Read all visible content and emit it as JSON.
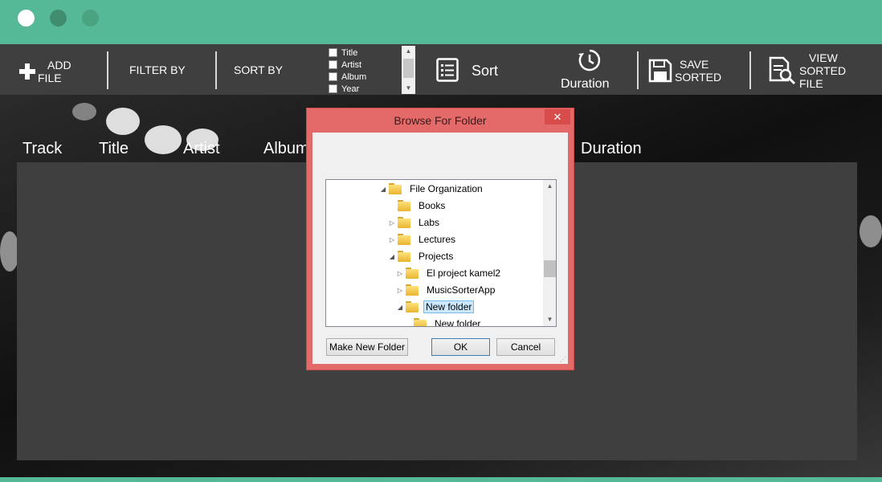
{
  "titlebar": {
    "accent": "#55b998"
  },
  "toolbar": {
    "add_file_line1": "ADD",
    "add_file_line2": "FILE",
    "filter_by": "FILTER BY",
    "sort_by": "SORT BY",
    "sort_fields": [
      "Title",
      "Artist",
      "Album",
      "Year"
    ],
    "sort_label": "Sort",
    "duration_label": "Duration",
    "save_line1": "SAVE",
    "save_line2": "SORTED",
    "view_line1": "VIEW",
    "view_line2": "SORTED",
    "view_line3": "FILE"
  },
  "columns": [
    "Track",
    "Title",
    "Artist",
    "Album",
    "Duration"
  ],
  "dialog": {
    "title": "Browse For Folder",
    "close_glyph": "✕",
    "tree": [
      {
        "label": "File Organization",
        "expander": "◢",
        "selected": false
      },
      {
        "label": "Books",
        "expander": "",
        "selected": false
      },
      {
        "label": "Labs",
        "expander": "▷",
        "selected": false
      },
      {
        "label": "Lectures",
        "expander": "▷",
        "selected": false
      },
      {
        "label": "Projects",
        "expander": "◢",
        "selected": false
      },
      {
        "label": "El project kamel2",
        "expander": "▷",
        "selected": false
      },
      {
        "label": "MusicSorterApp",
        "expander": "▷",
        "selected": false
      },
      {
        "label": "New folder",
        "expander": "◢",
        "selected": true
      },
      {
        "label": "New folder",
        "expander": "",
        "selected": false
      }
    ],
    "make_new_folder": "Make New Folder",
    "ok": "OK",
    "cancel": "Cancel"
  }
}
